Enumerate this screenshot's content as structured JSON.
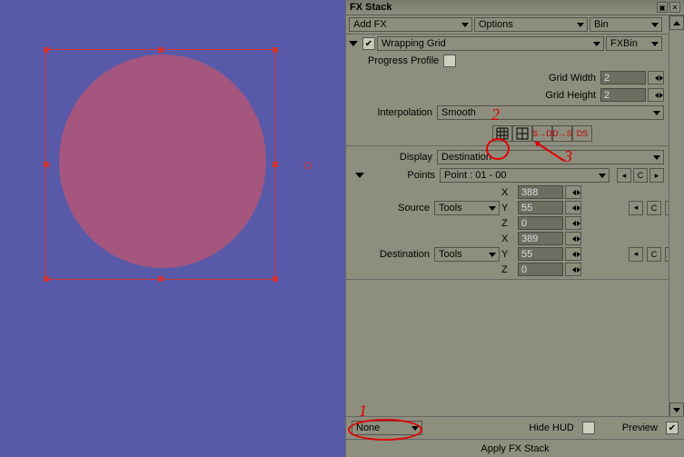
{
  "panel": {
    "title": "FX Stack"
  },
  "toolbar": {
    "add_fx": "Add FX",
    "options": "Options",
    "bin": "Bin"
  },
  "fx": {
    "name": "Wrapping Grid",
    "bin": "FXBin",
    "progress_label": "Progress Profile",
    "params": {
      "grid_width_label": "Grid Width",
      "grid_width": "2",
      "grid_height_label": "Grid Height",
      "grid_height": "2",
      "interpolation_label": "Interpolation",
      "interpolation_value": "Smooth",
      "display_label": "Display",
      "display_value": "Destination",
      "points_label": "Points",
      "points_value": "Point : 01 - 00",
      "source_label": "Source",
      "source_value": "Tools",
      "destination_label": "Destination",
      "destination_value": "Tools",
      "source_xyz": {
        "x_label": "X",
        "x": "388",
        "y_label": "Y",
        "y": "55",
        "z_label": "Z",
        "z": "0"
      },
      "dest_xyz": {
        "x_label": "X",
        "x": "389",
        "y_label": "Y",
        "y": "55",
        "z_label": "Z",
        "z": "0"
      }
    },
    "iconrow": {
      "sd": "S→D",
      "ds": "D→S",
      "ds2": "DS"
    }
  },
  "bottom": {
    "mode": "None",
    "hide_hud": "Hide HUD",
    "preview": "Preview",
    "apply": "Apply FX Stack"
  },
  "annotations": {
    "one": "1",
    "two": "2",
    "three": "3"
  },
  "c_label": "C"
}
